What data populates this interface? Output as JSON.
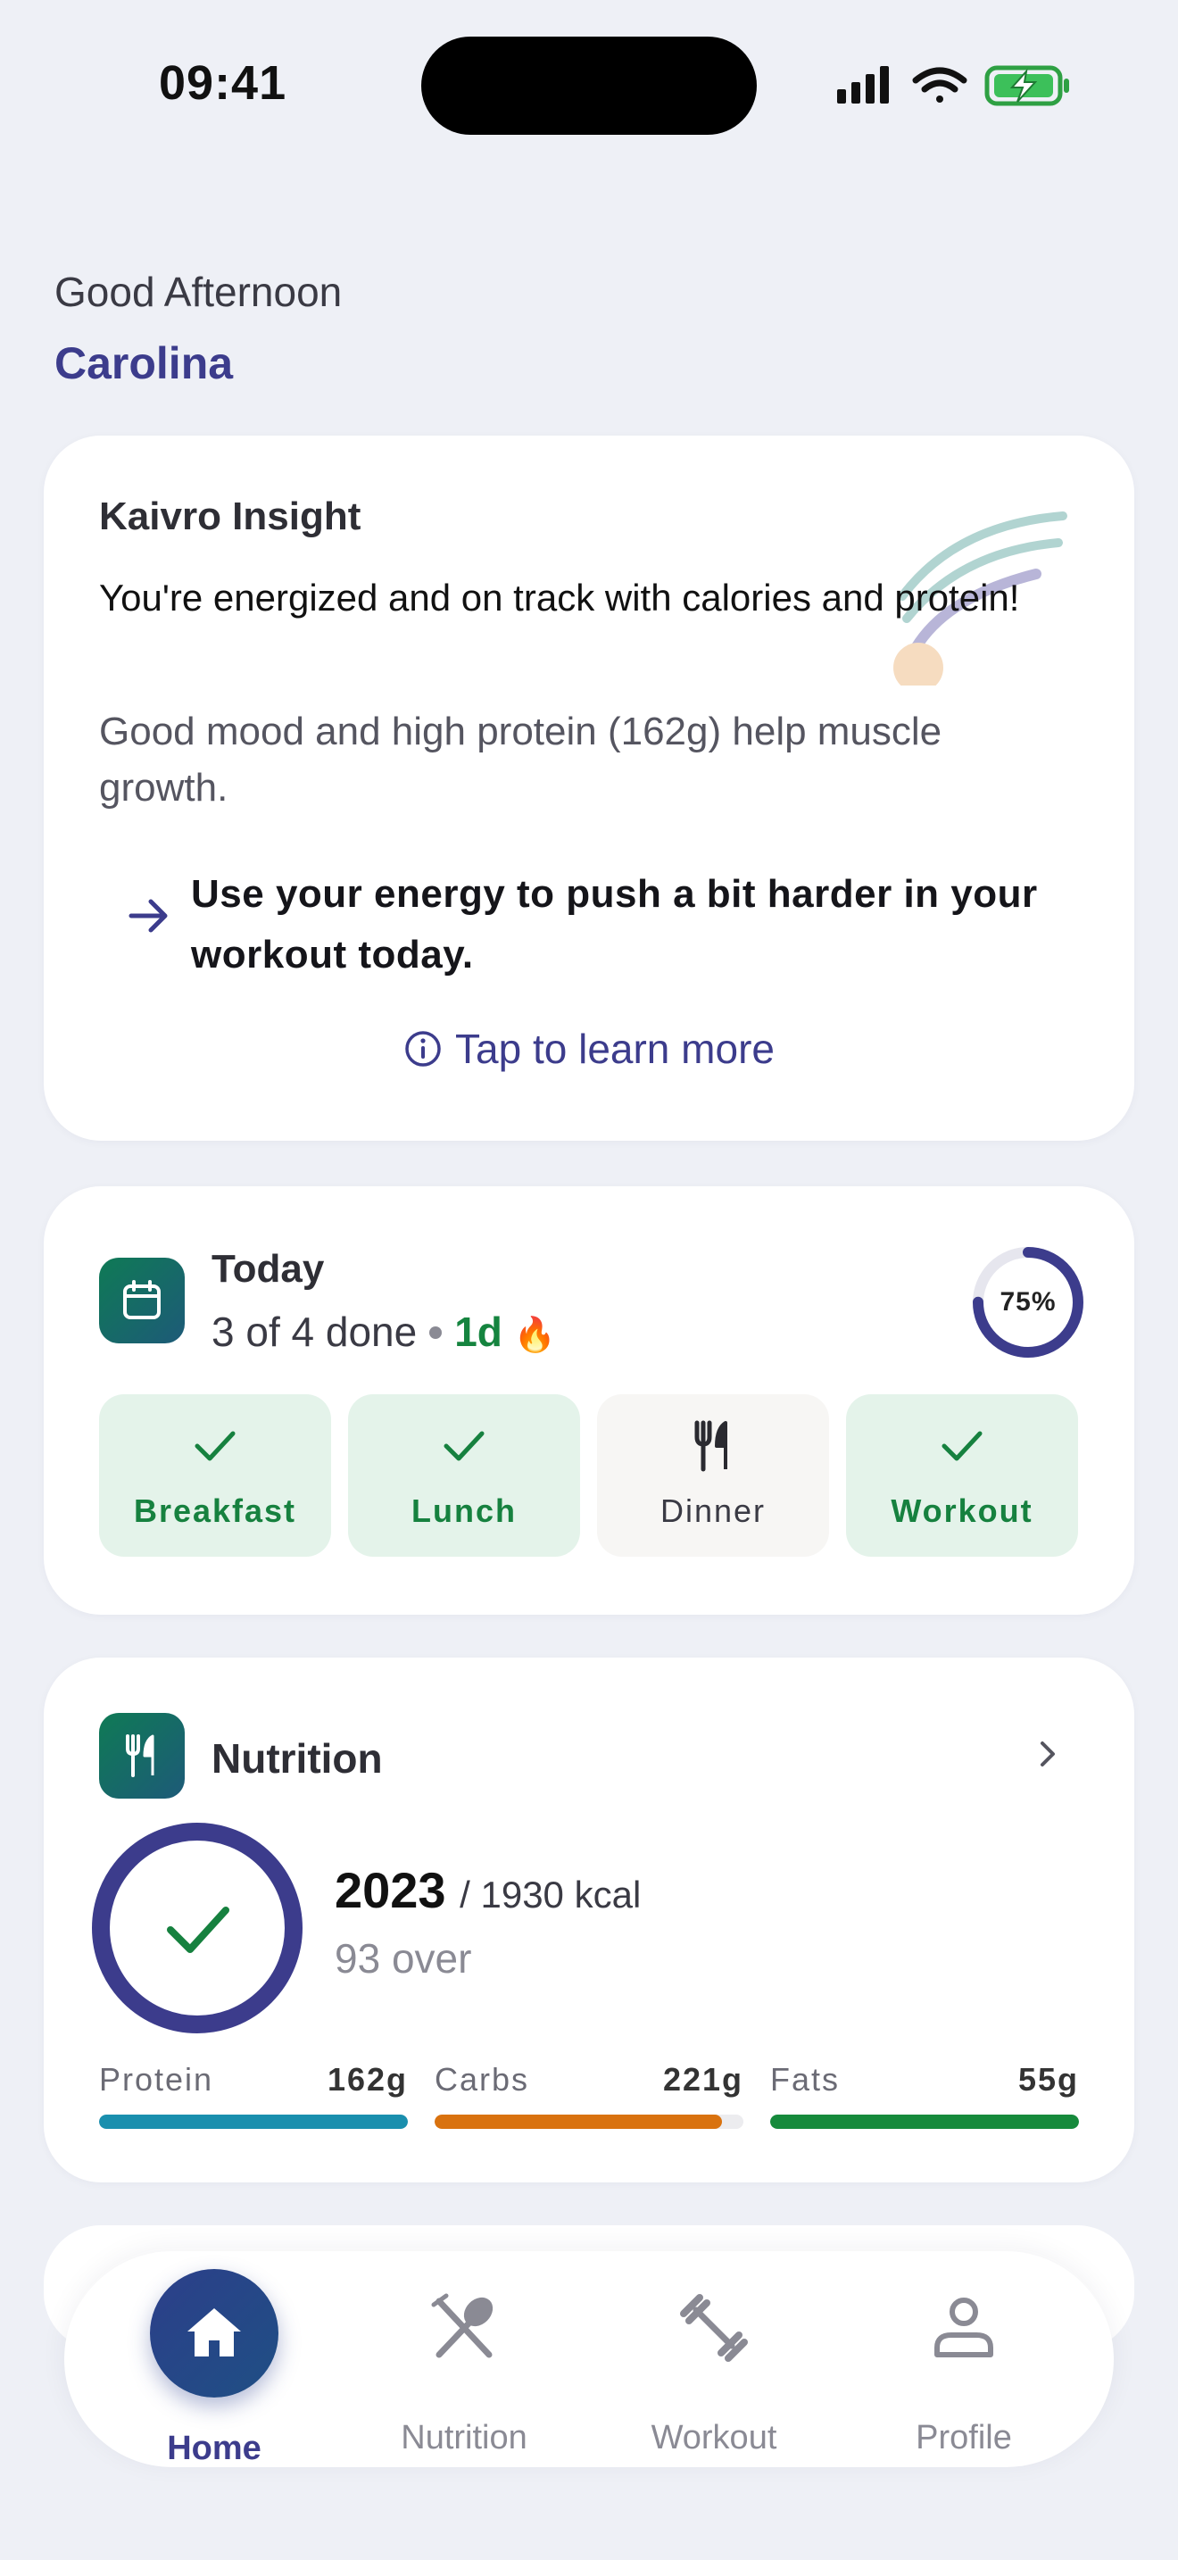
{
  "status_bar": {
    "time": "09:41"
  },
  "header": {
    "greeting": "Good Afternoon",
    "user_name": "Carolina"
  },
  "insight": {
    "title": "Kaivro Insight",
    "headline": "You're energized and on track with calories and protein!",
    "detail": "Good mood and high protein (162g) help muscle growth.",
    "action": "Use your energy to push a bit harder in your workout today.",
    "learn_more": "Tap to learn more"
  },
  "today": {
    "title": "Today",
    "progress_text": "3 of 4 done",
    "streak": "1d",
    "streak_emoji": "🔥",
    "percent_label": "75%",
    "percent": 0.75,
    "tasks": [
      {
        "label": "Breakfast",
        "done": true
      },
      {
        "label": "Lunch",
        "done": true
      },
      {
        "label": "Dinner",
        "done": false
      },
      {
        "label": "Workout",
        "done": true
      }
    ]
  },
  "nutrition": {
    "title": "Nutrition",
    "calories": "2023",
    "goal": "/ 1930 kcal",
    "over_text": "93 over",
    "macros": [
      {
        "name": "Protein",
        "value": "162g",
        "fill": 1.0,
        "color": "#1a8fae"
      },
      {
        "name": "Carbs",
        "value": "221g",
        "fill": 0.93,
        "color": "#d9720f"
      },
      {
        "name": "Fats",
        "value": "55g",
        "fill": 1.0,
        "color": "#168a3c"
      }
    ]
  },
  "tabs": [
    {
      "label": "Home",
      "icon": "home-icon",
      "active": true
    },
    {
      "label": "Nutrition",
      "icon": "fork-spoon-icon",
      "active": false
    },
    {
      "label": "Workout",
      "icon": "dumbbell-icon",
      "active": false
    },
    {
      "label": "Profile",
      "icon": "person-icon",
      "active": false
    }
  ],
  "colors": {
    "accent": "#3c3c8c",
    "success": "#16813f",
    "background": "#eef0f6"
  }
}
